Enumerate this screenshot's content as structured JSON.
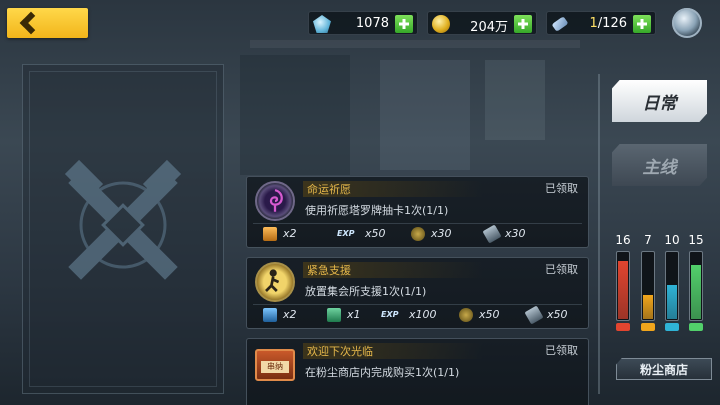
{
  "resources": {
    "gems": "1078",
    "coins": "204万",
    "tickets_current": "1",
    "tickets_max": "/126"
  },
  "tabs": {
    "daily": "日常",
    "main": "主线"
  },
  "tasks": [
    {
      "title": "命运祈愿",
      "desc": "使用祈愿塔罗牌抽卡1次(1/1)",
      "status": "已领取",
      "rewards": [
        {
          "icon": "potion-orange-icon",
          "label": "",
          "amount": "x2"
        },
        {
          "icon": "exp-icon",
          "label": "EXP",
          "amount": "x50"
        },
        {
          "icon": "badge-icon",
          "label": "",
          "amount": "x30"
        },
        {
          "icon": "chip-icon",
          "label": "",
          "amount": "x30"
        }
      ]
    },
    {
      "title": "紧急支援",
      "desc": "放置集会所支援1次(1/1)",
      "status": "已领取",
      "rewards": [
        {
          "icon": "potion-blue-icon",
          "label": "",
          "amount": "x2"
        },
        {
          "icon": "potion-green-icon",
          "label": "",
          "amount": "x1"
        },
        {
          "icon": "exp-icon",
          "label": "EXP",
          "amount": "x100"
        },
        {
          "icon": "badge-icon",
          "label": "",
          "amount": "x50"
        },
        {
          "icon": "chip-icon",
          "label": "",
          "amount": "x50"
        }
      ]
    },
    {
      "title": "欢迎下次光临",
      "desc": "在粉尘商店内完成购买1次(1/1)",
      "status": "已领取",
      "rewards": []
    }
  ],
  "gauges": [
    {
      "value": "16",
      "level": 0.85,
      "color": "#e2452f",
      "cap": "#e2452f"
    },
    {
      "value": "7",
      "level": 0.35,
      "color": "#f0a51c",
      "cap": "#f0a51c"
    },
    {
      "value": "10",
      "level": 0.5,
      "color": "#2fb3d6",
      "cap": "#2fb3d6"
    },
    {
      "value": "15",
      "level": 0.8,
      "color": "#52d06b",
      "cap": "#52d06b"
    }
  ],
  "shop": {
    "label": "粉尘商店"
  },
  "task3_icon_text": "串纳"
}
